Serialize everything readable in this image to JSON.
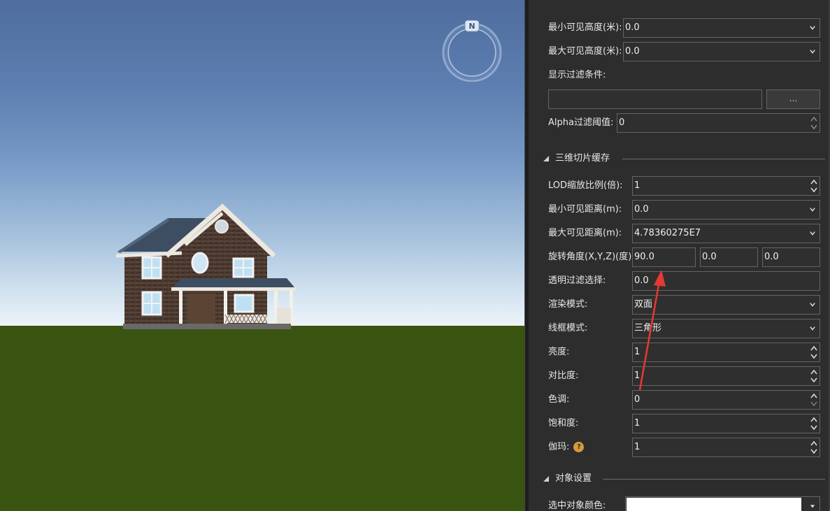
{
  "viewport": {
    "compass_label": "N",
    "colors": {
      "sky_top": "#4f6d9e",
      "sky_horizon": "#edf3f8",
      "ground": "#3a5412"
    }
  },
  "panel": {
    "fields_top": [
      {
        "label": "最小可见高度(米):",
        "value": "0.0",
        "kind": "combo"
      },
      {
        "label": "最大可见高度(米):",
        "value": "0.0",
        "kind": "combo"
      }
    ],
    "filter_label": "显示过滤条件:",
    "filter_value": "",
    "filter_button": "...",
    "alpha_label": "Alpha过滤阈值:",
    "alpha_value": "0",
    "section_tiles": "三维切片缓存",
    "lod_label": "LOD缩放比例(倍):",
    "lod_value": "1",
    "min_dist_label": "最小可见距离(m):",
    "min_dist_value": "0.0",
    "max_dist_label": "最大可见距离(m):",
    "max_dist_value": "4.78360275E7",
    "rotation_label": "旋转角度(X,Y,Z)(度):",
    "rotation_x": "90.0",
    "rotation_y": "0.0",
    "rotation_z": "0.0",
    "transparent_label": "透明过滤选择:",
    "transparent_value": "0.0",
    "render_mode_label": "渲染模式:",
    "render_mode_value": "双面",
    "wireframe_label": "线框模式:",
    "wireframe_value": "三角形",
    "brightness_label": "亮度:",
    "brightness_value": "1",
    "contrast_label": "对比度:",
    "contrast_value": "1",
    "hue_label": "色调:",
    "hue_value": "0",
    "saturation_label": "饱和度:",
    "saturation_value": "1",
    "gamma_label": "伽玛:",
    "gamma_help": "?",
    "gamma_value": "1",
    "section_object": "对象设置",
    "selected_color_label": "选中对象颜色:",
    "selected_color": "#ffffff"
  },
  "icons": {
    "combo": "chevron-down-icon",
    "spin": "spin-arrows-icon",
    "section": "collapse-triangle-icon",
    "help": "help-icon",
    "annotation": "red-arrow-annotation"
  },
  "colors": {
    "panel_bg": "#2d2d2d",
    "control_border": "#646464",
    "annotation_arrow": "#e53935",
    "help_badge": "#d79a3b"
  }
}
